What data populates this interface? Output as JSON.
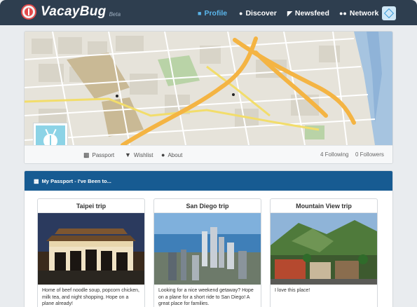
{
  "brand": {
    "name": "VacayBug",
    "badge": "Beta",
    "logo_icon": "ladybug-logo-icon",
    "accent": "#2e3e4f",
    "logo_color": "#e24a4a"
  },
  "nav": {
    "items": [
      {
        "label": "Profile",
        "icon": "user-icon",
        "active": true
      },
      {
        "label": "Discover",
        "icon": "globe-icon",
        "active": false
      },
      {
        "label": "Newsfeed",
        "icon": "rss-icon",
        "active": false
      },
      {
        "label": "Network",
        "icon": "users-icon",
        "active": false
      }
    ],
    "active_color": "#5bb6ec"
  },
  "profile": {
    "tabs": [
      {
        "label": "Passport",
        "icon": "briefcase-icon"
      },
      {
        "label": "Wishlist",
        "icon": "map-marker-icon"
      },
      {
        "label": "About",
        "icon": "info-icon"
      }
    ],
    "following": "4 Following",
    "followers": "0 Followers",
    "avatar_color": "#8cd3e6"
  },
  "passport": {
    "header": "My Passport - I've Been to...",
    "header_icon": "briefcase-icon",
    "header_color": "#175b92",
    "trips": [
      {
        "title": "Taipei trip",
        "description": "Home of beef noodle soup, popcorn chicken, milk tea, and night shopping. Hope on a plane already!"
      },
      {
        "title": "San Diego trip",
        "description": "Looking for a nice weekend getaway? Hope on a plane for a short ride to San Diego! A great place for families."
      },
      {
        "title": "Mountain View trip",
        "description": "I love this place!"
      }
    ]
  }
}
